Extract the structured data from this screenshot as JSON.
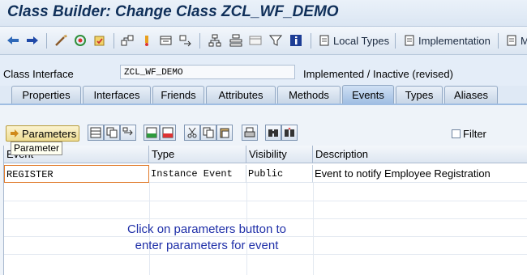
{
  "window": {
    "title": "Class Builder: Change Class ZCL_WF_DEMO"
  },
  "toolbar": {
    "icons": [
      "back-arrow-icon",
      "forward-arrow-icon",
      "display-change-icon",
      "activate-icon",
      "check-icon",
      "where-used-icon",
      "pointer-icon",
      "object-list-icon",
      "navigate-icon",
      "hierarchy-icon",
      "structure-icon",
      "window-icon",
      "filter-icon",
      "info-icon"
    ],
    "local_types_label": "Local Types",
    "implementation_label": "Implementation",
    "macros_label": "M"
  },
  "header": {
    "class_interface_label": "Class Interface",
    "class_interface_value": "ZCL_WF_DEMO",
    "status": "Implemented / Inactive (revised)"
  },
  "tabs": [
    {
      "label": "Properties",
      "active": false
    },
    {
      "label": "Interfaces",
      "active": false
    },
    {
      "label": "Friends",
      "active": false
    },
    {
      "label": "Attributes",
      "active": false
    },
    {
      "label": "Methods",
      "active": false
    },
    {
      "label": "Events",
      "active": true
    },
    {
      "label": "Types",
      "active": false
    },
    {
      "label": "Aliases",
      "active": false
    }
  ],
  "events_toolbar": {
    "parameters_label": "Parameters",
    "tooltip": "Parameter",
    "filter_label": "Filter",
    "icons": [
      "insert-row-icon",
      "copy-row-icon",
      "move-icon",
      "append-icon",
      "delete-row-icon",
      "cut-icon",
      "copy-icon",
      "paste-icon",
      "print-icon",
      "find-icon",
      "find-next-icon"
    ]
  },
  "table": {
    "columns": [
      "Event",
      "Type",
      "Visibility",
      "Description"
    ],
    "rows": [
      {
        "event": "REGISTER",
        "type": "Instance Event",
        "visibility": "Public",
        "description": "Event to notify Employee Registration"
      }
    ]
  },
  "annotation": {
    "line1": "Click on parameters button to",
    "line2": "enter parameters for event",
    "color": "#1f2fa8"
  }
}
